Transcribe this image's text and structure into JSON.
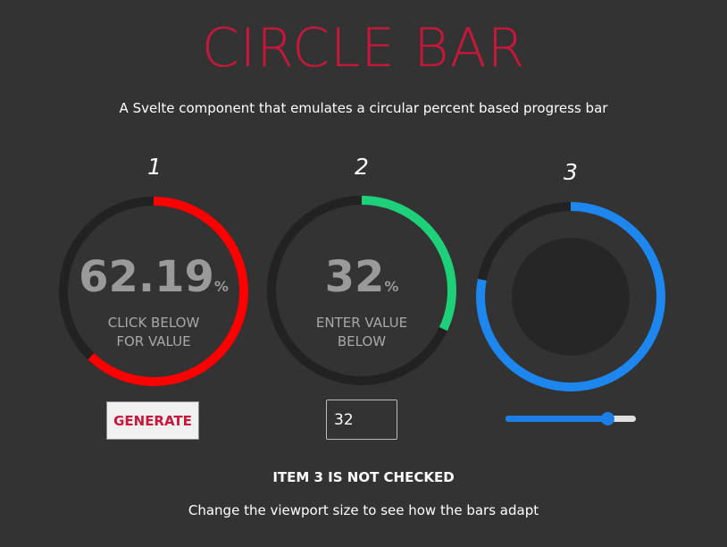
{
  "header": {
    "title": "CIRCLE BAR",
    "subtitle": "A Svelte component that emulates a circular percent based progress bar"
  },
  "bars": [
    {
      "number": "1",
      "value": "62.19",
      "percent_sign": "%",
      "caption_line1": "CLICK BELOW",
      "caption_line2": "FOR VALUE",
      "progress": 62.19,
      "color": "#ff0000"
    },
    {
      "number": "2",
      "value": "32",
      "percent_sign": "%",
      "caption_line1": "ENTER VALUE",
      "caption_line2": "BELOW",
      "progress": 32,
      "color": "#1fd07a"
    },
    {
      "number": "3",
      "progress": 78,
      "color": "#1e87ef"
    }
  ],
  "controls": {
    "generate_label": "GENERATE",
    "input_value": "32",
    "slider_value": 78
  },
  "status_text": "ITEM 3 IS NOT CHECKED",
  "footer_text": "Change the viewport size to see how the bars adapt",
  "colors": {
    "background": "#333333",
    "track": "#222222",
    "accent": "#c8173a",
    "inner_disc": "#262626"
  }
}
